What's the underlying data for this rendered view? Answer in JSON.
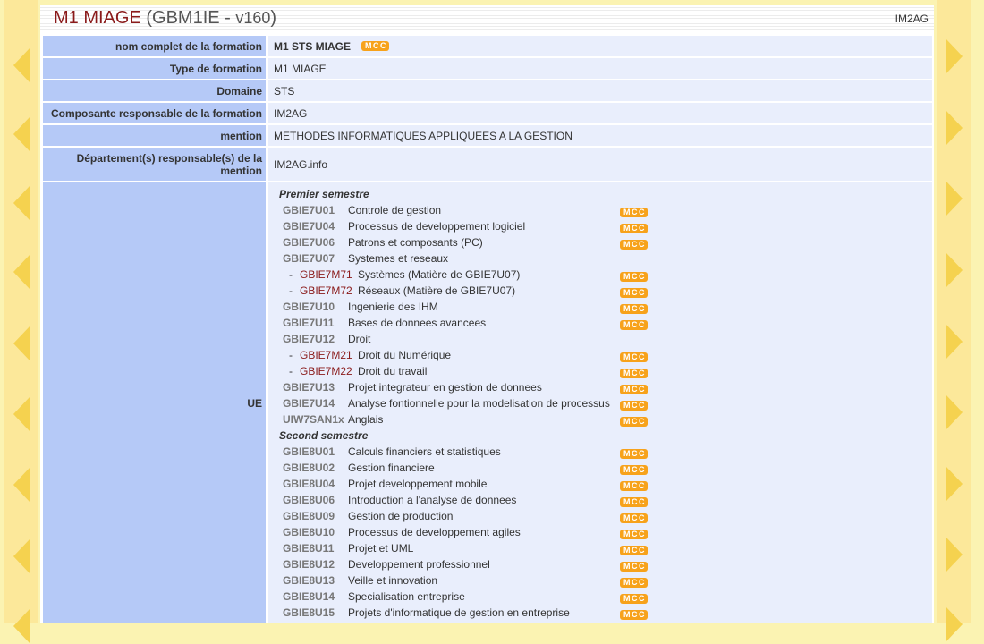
{
  "title": {
    "program": "M1 MIAGE",
    "code": "(GBM1IE - ",
    "version": "v160",
    "close": ")"
  },
  "corner_label": "IM2AG",
  "mcc_label": "MCC",
  "fields": [
    {
      "label": "nom complet de la formation",
      "value": "M1 STS MIAGE",
      "mcc": true
    },
    {
      "label": "Type de formation",
      "value": "M1 MIAGE"
    },
    {
      "label": "Domaine",
      "value": "STS"
    },
    {
      "label": "Composante responsable de la formation",
      "value": "IM2AG"
    },
    {
      "label": "mention",
      "value": "METHODES INFORMATIQUES APPLIQUEES A LA GESTION"
    },
    {
      "label": "Département(s) responsable(s) de la mention",
      "value": "IM2AG.info"
    }
  ],
  "ue_label": "UE",
  "semesters": [
    {
      "title": "Premier semestre",
      "items": [
        {
          "code": "GBIE7U01",
          "name": "Controle de gestion",
          "mcc": true
        },
        {
          "code": "GBIE7U04",
          "name": "Processus de developpement logiciel",
          "mcc": true
        },
        {
          "code": "GBIE7U06",
          "name": "Patrons et composants (PC)",
          "mcc": true
        },
        {
          "code": "GBIE7U07",
          "name": "Systemes et reseaux",
          "mcc": false,
          "children": [
            {
              "code": "GBIE7M71",
              "name": "Systèmes (Matière de GBIE7U07)",
              "mcc": true
            },
            {
              "code": "GBIE7M72",
              "name": "Réseaux (Matière de GBIE7U07)",
              "mcc": true
            }
          ]
        },
        {
          "code": "GBIE7U10",
          "name": "Ingenierie des IHM",
          "mcc": true
        },
        {
          "code": "GBIE7U11",
          "name": "Bases de donnees avancees",
          "mcc": true
        },
        {
          "code": "GBIE7U12",
          "name": "Droit",
          "mcc": false,
          "children": [
            {
              "code": "GBIE7M21",
              "name": "Droit du Numérique",
              "mcc": true
            },
            {
              "code": "GBIE7M22",
              "name": "Droit du travail",
              "mcc": true
            }
          ]
        },
        {
          "code": "GBIE7U13",
          "name": "Projet integrateur en gestion de donnees",
          "mcc": true
        },
        {
          "code": "GBIE7U14",
          "name": "Analyse fontionnelle pour la modelisation de processus",
          "mcc": true
        },
        {
          "code": "UIW7SAN1x",
          "name": "Anglais",
          "mcc": true
        }
      ]
    },
    {
      "title": "Second semestre",
      "items": [
        {
          "code": "GBIE8U01",
          "name": "Calculs financiers et statistiques",
          "mcc": true
        },
        {
          "code": "GBIE8U02",
          "name": "Gestion financiere",
          "mcc": true
        },
        {
          "code": "GBIE8U04",
          "name": "Projet developpement mobile",
          "mcc": true
        },
        {
          "code": "GBIE8U06",
          "name": "Introduction a l'analyse de donnees",
          "mcc": true
        },
        {
          "code": "GBIE8U09",
          "name": "Gestion de production",
          "mcc": true
        },
        {
          "code": "GBIE8U10",
          "name": "Processus de developpement agiles",
          "mcc": true
        },
        {
          "code": "GBIE8U11",
          "name": "Projet et UML",
          "mcc": true
        },
        {
          "code": "GBIE8U12",
          "name": "Developpement professionnel",
          "mcc": true
        },
        {
          "code": "GBIE8U13",
          "name": "Veille et innovation",
          "mcc": true
        },
        {
          "code": "GBIE8U14",
          "name": "Specialisation entreprise",
          "mcc": true
        },
        {
          "code": "GBIE8U15",
          "name": "Projets d'informatique de gestion en entreprise",
          "mcc": true
        }
      ]
    }
  ]
}
